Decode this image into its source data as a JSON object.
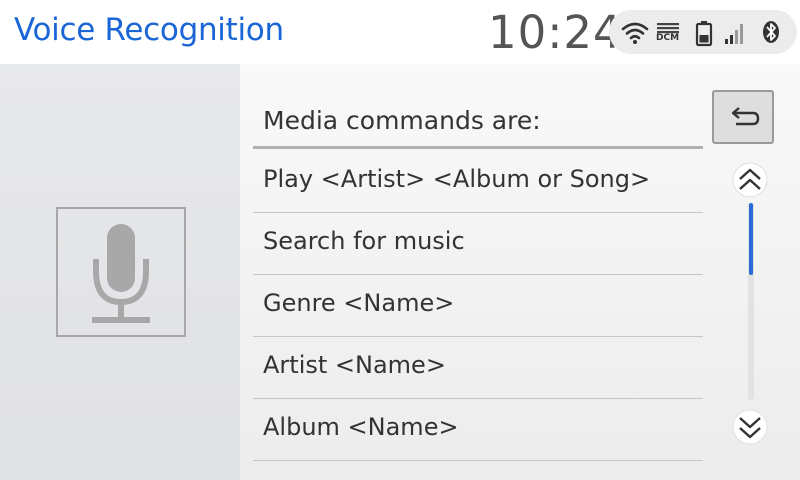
{
  "header": {
    "title": "Voice Recognition",
    "clock": "10:24",
    "status": {
      "icons": [
        "wifi-icon",
        "dcm-signal-icon",
        "battery-icon",
        "cell-signal-icon",
        "bluetooth-icon"
      ],
      "dcm_label": "DCM"
    }
  },
  "main": {
    "list_header": "Media commands are:",
    "commands": [
      "Play <Artist> <Album or Song>",
      "Search for music",
      "Genre <Name>",
      "Artist <Name>",
      "Album <Name>"
    ]
  },
  "controls": {
    "back_icon": "return-arrow-icon",
    "scroll_up_icon": "double-chevron-up-icon",
    "scroll_down_icon": "double-chevron-down-icon",
    "scroll_position": 0
  },
  "mic": {
    "icon": "microphone-icon"
  },
  "colors": {
    "title": "#1a66d6",
    "accent": "#2a6bd8"
  }
}
